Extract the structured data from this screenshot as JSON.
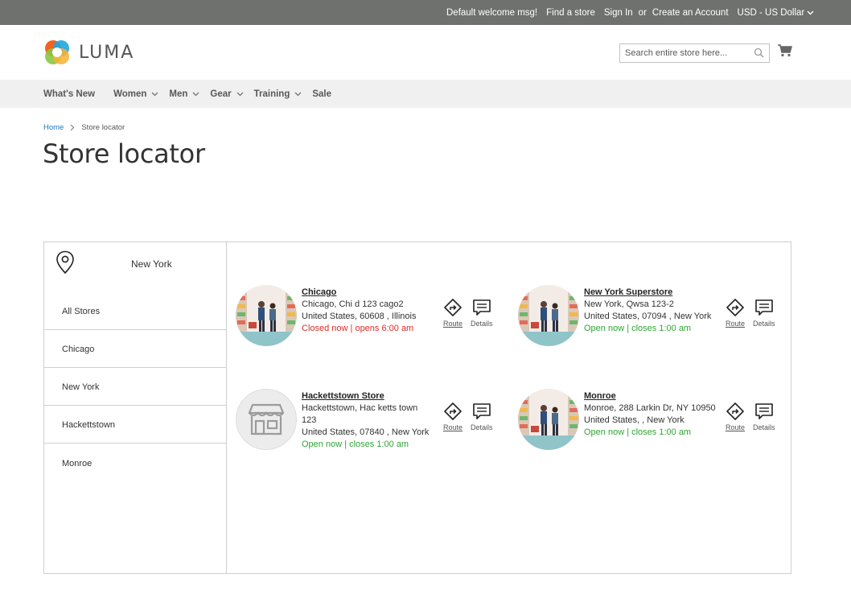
{
  "topbar": {
    "welcome": "Default welcome msg!",
    "find_store": "Find a store",
    "sign_in": "Sign In",
    "or": "or",
    "create_account": "Create an Account",
    "currency": "USD - US Dollar"
  },
  "header": {
    "logo_text": "LUMA",
    "search_placeholder": "Search entire store here..."
  },
  "nav": {
    "items": [
      {
        "label": "What's New",
        "dropdown": false
      },
      {
        "label": "Women",
        "dropdown": true
      },
      {
        "label": "Men",
        "dropdown": true
      },
      {
        "label": "Gear",
        "dropdown": true
      },
      {
        "label": "Training",
        "dropdown": true
      },
      {
        "label": "Sale",
        "dropdown": false
      }
    ]
  },
  "breadcrumb": {
    "home": "Home",
    "current": "Store locator"
  },
  "page_title": "Store locator",
  "locator": {
    "search_value": "New York",
    "filters": [
      "All Stores",
      "Chicago",
      "New York",
      "Hackettstown",
      "Monroe"
    ],
    "route_label": "Route",
    "details_label": "Details",
    "stores": [
      {
        "name": "Chicago",
        "line1": "Chicago, Chi d 123 cago2",
        "line2": "United States, 60608 , Illinois",
        "status": "Closed now | opens 6:00 am",
        "status_type": "closed",
        "image": "store-photo"
      },
      {
        "name": "New York Superstore",
        "line1": "New York, Qwsa 123-2",
        "line2": "United States, 07094 , New York",
        "status": "Open now | closes 1:00 am",
        "status_type": "open",
        "image": "store-photo"
      },
      {
        "name": "Hackettstown Store",
        "line1": "Hackettstown, Hac ketts town 123",
        "line2": "United States, 07840 , New York",
        "status": "Open now | closes 1:00 am",
        "status_type": "open",
        "image": "store-placeholder-icon"
      },
      {
        "name": "Monroe",
        "line1": "Monroe, 288 Larkin Dr, NY 10950",
        "line2": "United States, , New York",
        "status": "Open now | closes 1:00 am",
        "status_type": "open",
        "image": "store-photo"
      }
    ]
  },
  "colors": {
    "topbar_bg": "#6e716e",
    "nav_bg": "#f0f0f0",
    "link_blue": "#1979c3",
    "closed_red": "#e02b27",
    "open_green": "#2fa533"
  }
}
